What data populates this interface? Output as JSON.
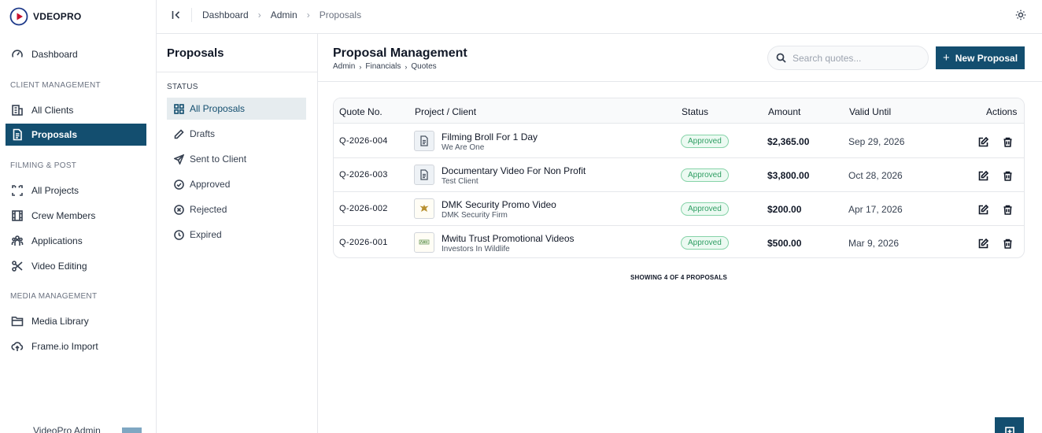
{
  "brand": {
    "name": "VDEOPRO",
    "color": "#c8102e"
  },
  "sidebar": {
    "dashboard": "Dashboard",
    "sections": {
      "client": "CLIENT MANAGEMENT",
      "filming": "FILMING & POST",
      "media": "MEDIA MANAGEMENT"
    },
    "items": {
      "all_clients": "All Clients",
      "proposals": "Proposals",
      "all_projects": "All Projects",
      "crew_members": "Crew Members",
      "applications": "Applications",
      "video_editing": "Video Editing",
      "media_library": "Media Library",
      "frameio_import": "Frame.io Import"
    },
    "user_name": "VideoPro Admin"
  },
  "topbar": {
    "breadcrumbs": [
      "Dashboard",
      "Admin",
      "Proposals"
    ]
  },
  "filters": {
    "title": "Proposals",
    "section_label": "STATUS",
    "items": [
      "All Proposals",
      "Drafts",
      "Sent to Client",
      "Approved",
      "Rejected",
      "Expired"
    ],
    "active": "All Proposals"
  },
  "main": {
    "title": "Proposal Management",
    "breadcrumbs": [
      "Admin",
      "Financials",
      "Quotes"
    ],
    "search_placeholder": "Search quotes...",
    "new_button": "New Proposal",
    "columns": [
      "Quote No.",
      "Project / Client",
      "Status",
      "Amount",
      "Valid Until",
      "Actions"
    ],
    "rows": [
      {
        "quote": "Q-2026-004",
        "project": "Filming Broll For 1 Day",
        "client": "We Are One",
        "status": "Approved",
        "amount": "$2,365.00",
        "valid": "Sep 29, 2026",
        "thumb": "document-icon"
      },
      {
        "quote": "Q-2026-003",
        "project": "Documentary Video For Non Profit",
        "client": "Test Client",
        "status": "Approved",
        "amount": "$3,800.00",
        "valid": "Oct 28, 2026",
        "thumb": "document-icon"
      },
      {
        "quote": "Q-2026-002",
        "project": "DMK Security Promo Video",
        "client": "DMK Security Firm",
        "status": "Approved",
        "amount": "$200.00",
        "valid": "Apr 17, 2026",
        "thumb": "eagle-logo"
      },
      {
        "quote": "Q-2026-001",
        "project": "Mwitu Trust Promotional Videos",
        "client": "Investors In Wildlife",
        "status": "Approved",
        "amount": "$500.00",
        "valid": "Mar 9, 2026",
        "thumb": "ambi-logo"
      }
    ],
    "showing": "SHOWING 4 OF 4 PROPOSALS"
  },
  "colors": {
    "accent": "#134e6f",
    "approved": "#2f9e63"
  }
}
